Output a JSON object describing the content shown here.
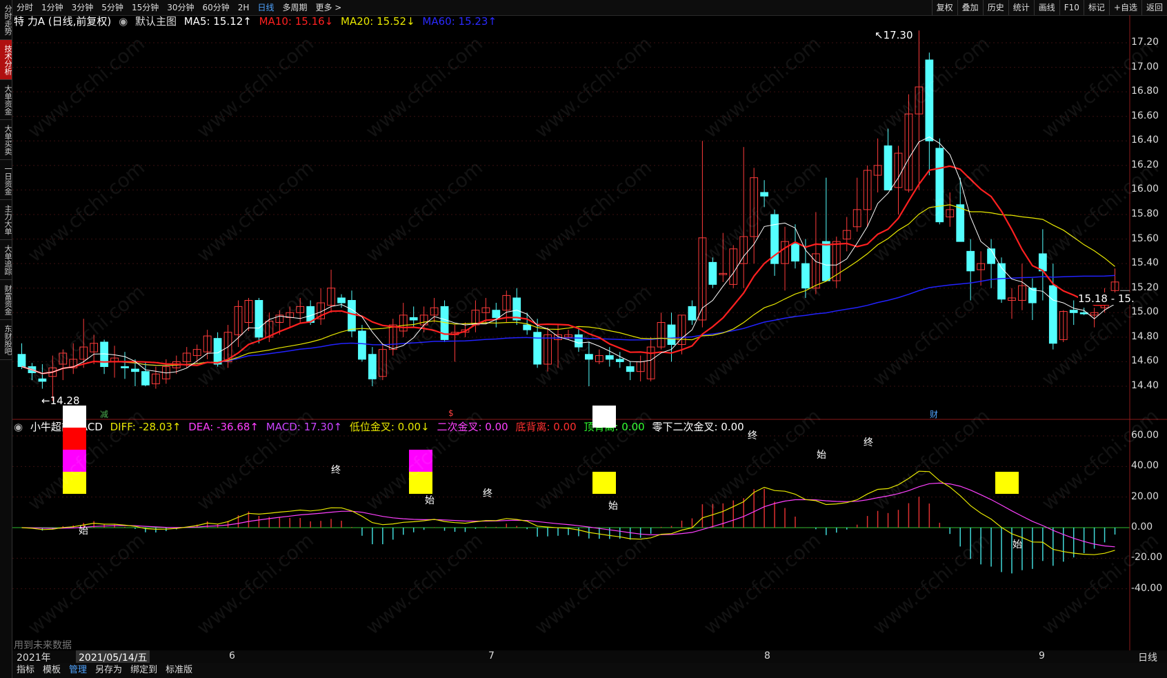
{
  "sidebar": {
    "items": [
      {
        "label": "分时走势",
        "active": false
      },
      {
        "label": "技术分析",
        "active": true
      },
      {
        "label": "大单资金",
        "active": false
      },
      {
        "label": "大单买卖",
        "active": false
      },
      {
        "label": "一日资金",
        "active": false
      },
      {
        "label": "主力大单",
        "active": false
      },
      {
        "label": "大单追踪",
        "active": false
      },
      {
        "label": "财富资金",
        "active": false
      },
      {
        "label": "东财股吧",
        "active": false
      }
    ]
  },
  "topbar": {
    "periods": [
      {
        "label": "分时",
        "active": false
      },
      {
        "label": "1分钟",
        "active": false
      },
      {
        "label": "3分钟",
        "active": false
      },
      {
        "label": "5分钟",
        "active": false
      },
      {
        "label": "15分钟",
        "active": false
      },
      {
        "label": "30分钟",
        "active": false
      },
      {
        "label": "60分钟",
        "active": false
      },
      {
        "label": "2H",
        "active": false
      },
      {
        "label": "日线",
        "active": true
      },
      {
        "label": "多周期",
        "active": false
      },
      {
        "label": "更多 >",
        "active": false
      }
    ],
    "right_buttons": [
      "复权",
      "叠加",
      "历史",
      "统计",
      "画线",
      "F10",
      "标记",
      "+自选",
      "返回"
    ]
  },
  "main_legend": {
    "stock": "特 力A (日线,前复权)",
    "indicator": "默认主图",
    "ma5": "MA5: 15.12↑",
    "ma10": "MA10: 15.16↓",
    "ma20": "MA20: 15.52↓",
    "ma60": "MA60: 15.23↑"
  },
  "macd_legend": {
    "name": "小牛超前MACD",
    "diff": "DIFF: -28.03↑",
    "dea": "DEA: -36.68↑",
    "macd": "MACD: 17.30↑",
    "low_cross": "低位金叉: 0.00↓",
    "second_cross": "二次金叉: 0.00",
    "bottom_div": "底背离: 0.00",
    "top_div": "顶背离: 0.00",
    "zero_second": "零下二次金叉: 0.00"
  },
  "price_axis": [
    "17.20",
    "17.00",
    "16.80",
    "16.60",
    "16.40",
    "16.20",
    "16.00",
    "15.80",
    "15.60",
    "15.40",
    "15.20",
    "15.00",
    "14.80",
    "14.60",
    "14.40"
  ],
  "macd_axis": [
    "60.00",
    "40.00",
    "20.00",
    "0.00",
    "-20.00",
    "-40.00"
  ],
  "annotations": {
    "high": "17.30",
    "low": "14.28",
    "current_price": "15.18 - 15.",
    "marker_jian": "减",
    "marker_dollar": "$",
    "marker_cai": "财",
    "future_note": "用到未来数据",
    "shi": "始",
    "zhong": "终"
  },
  "x_axis": {
    "year": "2021年",
    "date": "2021/05/14/五",
    "months": [
      "6",
      "7",
      "8",
      "9"
    ],
    "period_label": "日线"
  },
  "bottom_tabs": [
    "指标",
    "模板",
    "管理",
    "另存为",
    "绑定到",
    "标准版"
  ],
  "colors": {
    "up": "#ff3b3b",
    "down": "#54ffff",
    "ma5": "#ffffff",
    "ma10": "#ff2020",
    "ma20": "#e8e800",
    "ma60": "#2222ff",
    "diff": "#e8e800",
    "dea": "#ff40ff"
  },
  "watermark": "www.cfchi.com",
  "candles": [
    [
      14.66,
      14.75,
      14.54,
      14.56
    ],
    [
      14.56,
      14.59,
      14.45,
      14.51
    ],
    [
      14.46,
      14.58,
      14.38,
      14.44
    ],
    [
      14.48,
      14.65,
      14.28,
      14.55
    ],
    [
      14.58,
      14.7,
      14.45,
      14.67
    ],
    [
      14.55,
      14.75,
      14.5,
      14.62
    ],
    [
      14.62,
      14.95,
      14.55,
      14.72
    ],
    [
      14.68,
      14.82,
      14.58,
      14.75
    ],
    [
      14.76,
      14.78,
      14.5,
      14.56
    ],
    [
      14.6,
      14.73,
      14.47,
      14.63
    ],
    [
      14.56,
      14.68,
      14.46,
      14.55
    ],
    [
      14.54,
      14.62,
      14.4,
      14.52
    ],
    [
      14.52,
      14.6,
      14.4,
      14.41
    ],
    [
      14.42,
      14.56,
      14.38,
      14.5
    ],
    [
      14.46,
      14.62,
      14.42,
      14.56
    ],
    [
      14.55,
      14.65,
      14.5,
      14.6
    ],
    [
      14.6,
      14.72,
      14.55,
      14.67
    ],
    [
      14.65,
      14.74,
      14.58,
      14.7
    ],
    [
      14.68,
      14.86,
      14.62,
      14.81
    ],
    [
      14.79,
      14.84,
      14.56,
      14.58
    ],
    [
      14.6,
      14.9,
      14.55,
      14.84
    ],
    [
      14.82,
      15.1,
      14.72,
      15.05
    ],
    [
      14.92,
      15.12,
      14.85,
      15.1
    ],
    [
      15.1,
      15.12,
      14.75,
      14.8
    ],
    [
      14.8,
      15.0,
      14.76,
      14.93
    ],
    [
      14.92,
      15.02,
      14.82,
      14.98
    ],
    [
      14.96,
      15.05,
      14.88,
      15.0
    ],
    [
      15.0,
      15.12,
      14.92,
      15.05
    ],
    [
      15.05,
      15.1,
      14.9,
      14.92
    ],
    [
      14.95,
      15.2,
      14.9,
      15.08
    ],
    [
      15.06,
      15.35,
      15.0,
      15.2
    ],
    [
      15.12,
      15.15,
      15.04,
      15.08
    ],
    [
      15.1,
      15.18,
      14.8,
      14.85
    ],
    [
      14.85,
      14.9,
      14.6,
      14.62
    ],
    [
      14.66,
      14.72,
      14.4,
      14.46
    ],
    [
      14.48,
      14.75,
      14.45,
      14.7
    ],
    [
      14.7,
      14.95,
      14.65,
      14.9
    ],
    [
      14.85,
      15.08,
      14.8,
      14.98
    ],
    [
      14.96,
      15.05,
      14.88,
      14.94
    ],
    [
      14.9,
      15.05,
      14.84,
      14.98
    ],
    [
      14.98,
      15.12,
      14.92,
      15.04
    ],
    [
      15.05,
      15.1,
      14.76,
      14.78
    ],
    [
      14.82,
      14.9,
      14.6,
      14.84
    ],
    [
      14.84,
      14.92,
      14.8,
      14.86
    ],
    [
      14.9,
      15.1,
      14.84,
      15.02
    ],
    [
      15.0,
      15.12,
      14.92,
      15.04
    ],
    [
      15.02,
      15.08,
      14.88,
      14.96
    ],
    [
      15.02,
      15.18,
      14.92,
      15.14
    ],
    [
      15.12,
      15.2,
      14.9,
      14.94
    ],
    [
      14.9,
      15.0,
      14.82,
      14.86
    ],
    [
      14.84,
      14.95,
      14.55,
      14.58
    ],
    [
      14.58,
      14.88,
      14.52,
      14.82
    ],
    [
      14.78,
      14.9,
      14.55,
      14.82
    ],
    [
      14.8,
      14.86,
      14.78,
      14.82
    ],
    [
      14.82,
      14.88,
      14.68,
      14.72
    ],
    [
      14.66,
      14.76,
      14.4,
      14.62
    ],
    [
      14.6,
      14.7,
      14.58,
      14.65
    ],
    [
      14.65,
      14.72,
      14.56,
      14.62
    ],
    [
      14.62,
      14.68,
      14.55,
      14.6
    ],
    [
      14.56,
      14.6,
      14.45,
      14.52
    ],
    [
      14.52,
      14.65,
      14.44,
      14.6
    ],
    [
      14.46,
      14.8,
      14.44,
      14.72
    ],
    [
      14.72,
      15.0,
      14.7,
      14.92
    ],
    [
      14.9,
      15.0,
      14.6,
      14.74
    ],
    [
      14.74,
      14.98,
      14.66,
      14.98
    ],
    [
      15.05,
      15.1,
      14.9,
      14.94
    ],
    [
      14.94,
      16.4,
      14.88,
      15.61
    ],
    [
      15.41,
      15.45,
      15.2,
      15.23
    ],
    [
      15.31,
      15.65,
      15.25,
      15.32
    ],
    [
      15.23,
      15.55,
      15.2,
      15.52
    ],
    [
      15.4,
      16.35,
      15.2,
      15.62
    ],
    [
      15.62,
      16.18,
      15.4,
      16.1
    ],
    [
      15.98,
      16.08,
      15.86,
      15.95
    ],
    [
      15.8,
      15.84,
      15.3,
      15.4
    ],
    [
      15.4,
      15.7,
      15.18,
      15.58
    ],
    [
      15.56,
      15.72,
      15.36,
      15.42
    ],
    [
      15.4,
      15.6,
      15.12,
      15.2
    ],
    [
      15.2,
      15.82,
      15.15,
      15.48
    ],
    [
      15.58,
      16.1,
      15.26,
      15.26
    ],
    [
      15.26,
      15.62,
      15.2,
      15.58
    ],
    [
      15.6,
      15.78,
      15.5,
      15.67
    ],
    [
      15.7,
      16.1,
      15.66,
      15.84
    ],
    [
      15.84,
      16.2,
      15.7,
      16.16
    ],
    [
      16.12,
      16.42,
      15.98,
      16.2
    ],
    [
      16.36,
      16.5,
      16.1,
      16.0
    ],
    [
      16.02,
      16.36,
      15.8,
      16.3
    ],
    [
      16.0,
      16.78,
      15.98,
      16.62
    ],
    [
      16.62,
      17.3,
      16.0,
      16.84
    ],
    [
      17.06,
      17.12,
      16.12,
      16.4
    ],
    [
      16.34,
      16.42,
      15.72,
      15.74
    ],
    [
      15.78,
      15.98,
      15.7,
      15.84
    ],
    [
      15.88,
      16.1,
      15.58,
      15.58
    ],
    [
      15.5,
      15.6,
      15.1,
      15.34
    ],
    [
      15.35,
      15.5,
      15.22,
      15.4
    ],
    [
      15.52,
      15.6,
      15.2,
      15.4
    ],
    [
      15.4,
      15.45,
      15.08,
      15.11
    ],
    [
      15.1,
      15.2,
      14.95,
      15.12
    ],
    [
      15.1,
      15.4,
      15.02,
      15.22
    ],
    [
      15.2,
      15.28,
      14.94,
      15.08
    ],
    [
      15.48,
      15.68,
      15.1,
      15.34
    ],
    [
      15.22,
      15.4,
      14.7,
      14.75
    ],
    [
      14.78,
      15.02,
      14.76,
      15.01
    ],
    [
      15.02,
      15.1,
      14.9,
      15.0
    ],
    [
      15.0,
      15.04,
      14.98,
      14.99
    ],
    [
      14.98,
      15.04,
      14.88,
      15.0
    ],
    [
      15.04,
      15.2,
      15.0,
      15.11
    ],
    [
      15.18,
      15.36,
      15.15,
      15.25
    ]
  ]
}
